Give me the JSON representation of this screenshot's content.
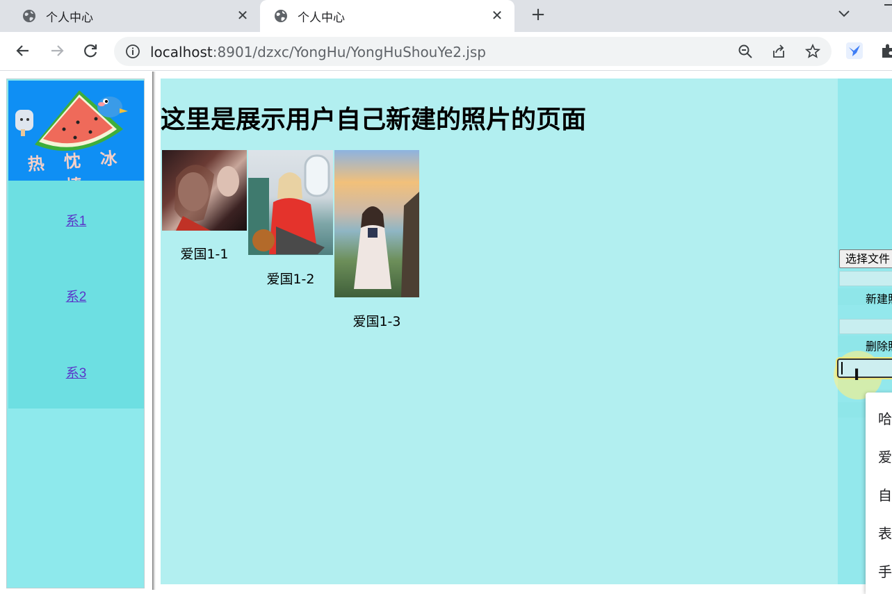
{
  "tabs": [
    {
      "title": "个人中心",
      "active": false
    },
    {
      "title": "个人中心",
      "active": true
    }
  ],
  "toolbar": {
    "url_host": "localhost",
    "url_path": ":8901/dzxc/YongHu/YongHuShouYe2.jsp"
  },
  "sidebar": {
    "logo_text": "热 忱 冰 棒",
    "items": [
      {
        "label": "系1"
      },
      {
        "label": "系2"
      },
      {
        "label": "系3"
      }
    ]
  },
  "main": {
    "heading": "这里是展示用户自己新建的照片的页面",
    "photos": [
      {
        "caption": "爱国1-1"
      },
      {
        "caption": "爱国1-2"
      },
      {
        "caption": "爱国1-3"
      }
    ]
  },
  "rightpanel": {
    "file_button": "选择文件",
    "create_label": "新建照",
    "delete_label": "删除照"
  },
  "autocomplete": {
    "items": [
      "哈",
      "爱",
      "自",
      "表",
      "手"
    ]
  },
  "colors": {
    "sidebar_bg": "#8ee9ec",
    "main_bg": "#b2eff0",
    "logo_bg": "#0f8ff4",
    "link": "#5a34c8"
  }
}
